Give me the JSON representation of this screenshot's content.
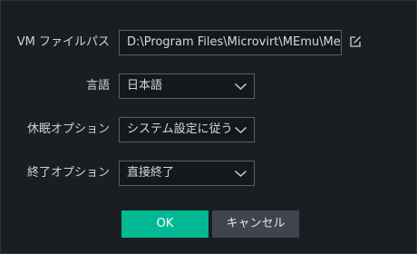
{
  "form": {
    "vm_folder": {
      "label": "VM ファイルパス",
      "value": "D:\\Program Files\\Microvirt\\MEmu\\MemuHyperv VMs"
    },
    "language": {
      "label": "言語",
      "selected": "日本語"
    },
    "sleep_option": {
      "label": "休眠オプション",
      "selected": "システム設定に従う"
    },
    "exit_option": {
      "label": "終了オプション",
      "selected": "直接終了"
    }
  },
  "buttons": {
    "ok_label": "OK",
    "cancel_label": "キャンセル"
  },
  "icons": {
    "edit": "edit-icon",
    "dropdown": "chevron-down-icon"
  },
  "colors": {
    "background": "#1a1e22",
    "accent": "#00b894",
    "secondary_button": "#3e454c",
    "field_border": "#5a5f64"
  }
}
